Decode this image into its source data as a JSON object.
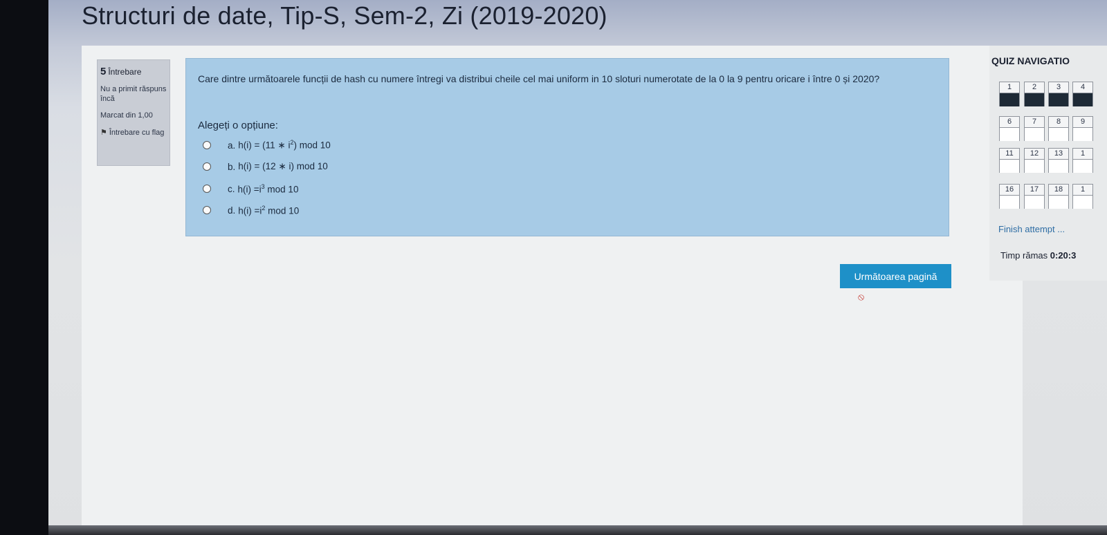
{
  "page": {
    "title": "Structuri de date, Tip-S, Sem-2, Zi (2019-2020)"
  },
  "question_info": {
    "number": "5",
    "number_label": "Întrebare",
    "status": "Nu a primit răspuns încă",
    "mark": "Marcat din 1,00",
    "flag_label": "Întrebare cu flag"
  },
  "question": {
    "text": "Care dintre următoarele funcții de hash cu numere întregi va distribui cheile cel mai uniform in 10 sloturi numerotate de la 0 la 9 pentru oricare i între 0 și 2020?",
    "prompt": "Alegeți o opțiune:",
    "answers": [
      {
        "letter": "a.",
        "expr": "h(i) = (11 ∗ i",
        "sup": "2",
        "rest": ") mod 10",
        "selected": false
      },
      {
        "letter": "b.",
        "expr": "h(i) = (12 ∗ i) mod 10",
        "sup": "",
        "rest": "",
        "selected": false
      },
      {
        "letter": "c.",
        "expr": "h(i) =i",
        "sup": "3",
        "rest": " mod 10",
        "selected": false
      },
      {
        "letter": "d.",
        "expr": "h(i) =i",
        "sup": "2",
        "rest": " mod 10",
        "selected": false
      }
    ]
  },
  "buttons": {
    "next_page": "Următoarea pagină"
  },
  "nav": {
    "title": "QUIZ NAVIGATIO",
    "rows": [
      [
        {
          "label": "1",
          "answered": true
        },
        {
          "label": "2",
          "answered": true
        },
        {
          "label": "3",
          "answered": true
        },
        {
          "label": "4",
          "answered": true
        }
      ],
      [
        {
          "label": "6",
          "answered": false
        },
        {
          "label": "7",
          "answered": false
        },
        {
          "label": "8",
          "answered": false
        },
        {
          "label": "9",
          "answered": false
        }
      ],
      [
        {
          "label": "11",
          "answered": false
        },
        {
          "label": "12",
          "answered": false
        },
        {
          "label": "13",
          "answered": false
        },
        {
          "label": "1",
          "answered": false
        }
      ],
      [
        {
          "label": "16",
          "answered": false
        },
        {
          "label": "17",
          "answered": false
        },
        {
          "label": "18",
          "answered": false
        },
        {
          "label": "1",
          "answered": false
        }
      ]
    ],
    "finish_link": "Finish attempt ...",
    "timer_label": "Timp rămas",
    "timer_value": "0:20:3"
  },
  "icons": {
    "flag": "flag-icon",
    "block": "no-entry-icon"
  },
  "colors": {
    "question_bg": "#a7cbe6",
    "button_bg": "#1e90c8",
    "answered_fill": "#1e2a36",
    "link": "#2e6da4"
  }
}
